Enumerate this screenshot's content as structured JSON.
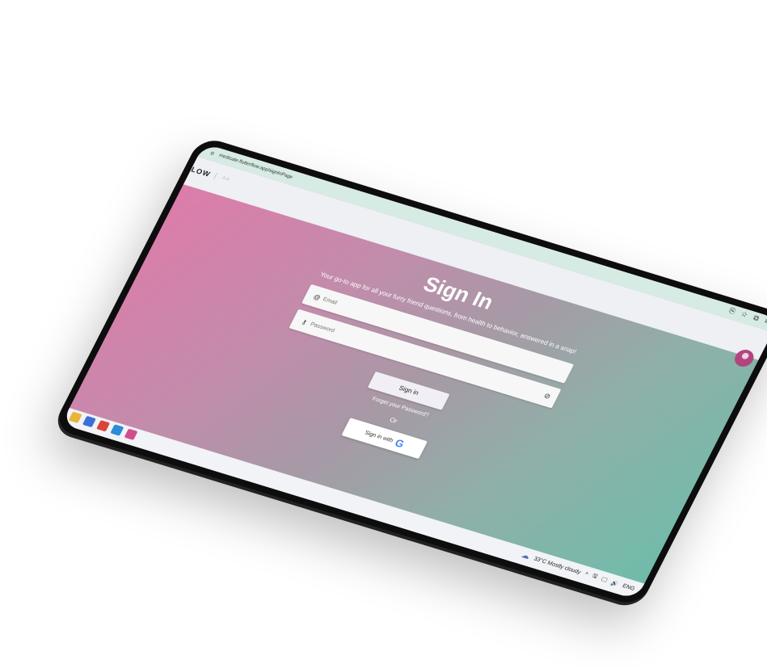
{
  "browser": {
    "url": "medicate.flutterflow.app/signInPage",
    "actions": [
      "⎘",
      "☆",
      "⧉",
      "≡"
    ]
  },
  "header": {
    "brand": "FLOW",
    "brand_sep": "|",
    "brand_sub": "a a"
  },
  "signin": {
    "title": "Sign In",
    "subtitle": "Your go-to app for all your furry friend questions, from health to behavior, answered in a snap!",
    "email_placeholder": "Email",
    "password_placeholder": "Password",
    "signin_label": "Sign in",
    "forgot_label": "Forget your Password?",
    "or_label": "Or",
    "google_label": "Sign in with",
    "google_logo": "G"
  },
  "taskbar": {
    "weather": "33°C  Mostly cloudy",
    "language": "ENG",
    "tray_icons": [
      "^",
      "🖫",
      "🖵",
      "🔊"
    ],
    "apps": [
      {
        "name": "app-explorer",
        "color": "#e8b43a"
      },
      {
        "name": "app-store",
        "color": "#3b6fd8"
      },
      {
        "name": "app-chrome",
        "color": "#d9453b"
      },
      {
        "name": "app-edge",
        "color": "#2a8bd8"
      },
      {
        "name": "app-other",
        "color": "#d24d8f"
      }
    ]
  },
  "colors": {
    "gradient_start": "#e07aaa",
    "gradient_end": "#6fbcab",
    "avatar": "#b2457e"
  }
}
